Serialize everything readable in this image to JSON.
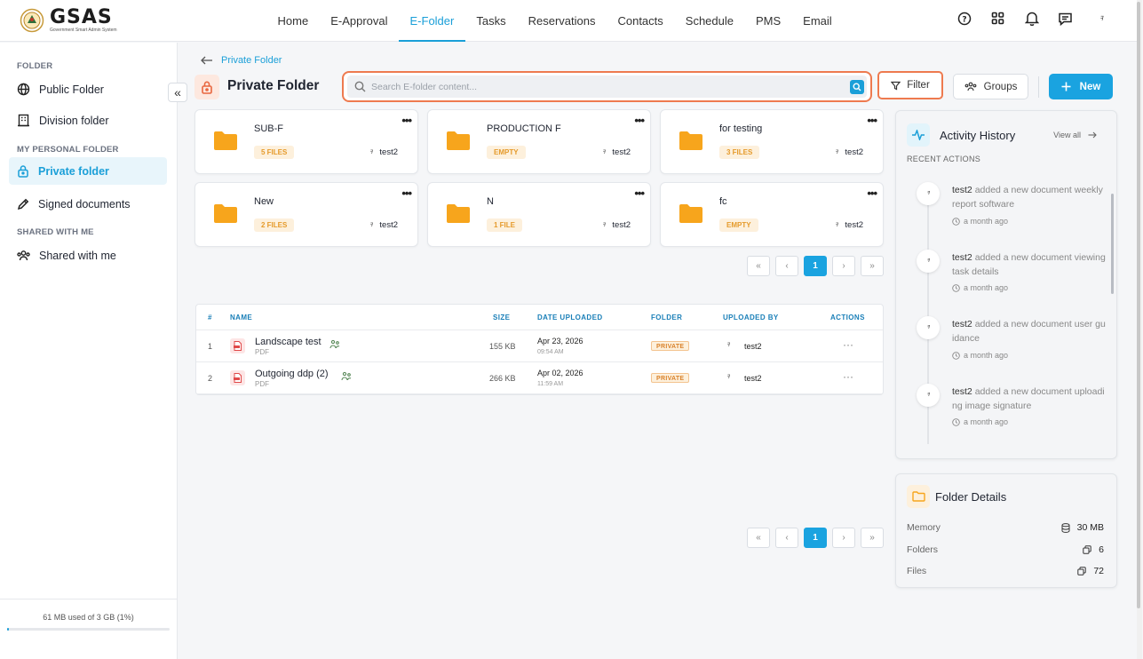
{
  "brand": {
    "name": "GSAS",
    "subtitle": "Government Smart Admin System"
  },
  "nav": [
    "Home",
    "E-Approval",
    "E-Folder",
    "Tasks",
    "Reservations",
    "Contacts",
    "Schedule",
    "PMS",
    "Email"
  ],
  "nav_active": "E-Folder",
  "user_signature": "ꟻ",
  "sidebar": {
    "section_folder": "FOLDER",
    "public_folder": "Public Folder",
    "division_folder": "Division folder",
    "section_personal": "MY PERSONAL FOLDER",
    "private_folder": "Private folder",
    "signed_documents": "Signed documents",
    "section_shared": "SHARED WITH ME",
    "shared_with_me": "Shared with me",
    "storage_text": "61 MB used of 3 GB (1%)",
    "storage_percent": 1
  },
  "header": {
    "breadcrumb": "Private Folder",
    "title": "Private Folder",
    "search_placeholder": "Search E-folder content...",
    "filter_label": "Filter",
    "groups_label": "Groups",
    "new_label": "New"
  },
  "folders": [
    {
      "name": "SUB-F",
      "badge": "5 FILES",
      "owner": "test2"
    },
    {
      "name": "PRODUCTION F",
      "badge": "EMPTY",
      "owner": "test2"
    },
    {
      "name": "for testing",
      "badge": "3 FILES",
      "owner": "test2"
    },
    {
      "name": "New",
      "badge": "2 FILES",
      "owner": "test2"
    },
    {
      "name": "N",
      "badge": "1 FILE",
      "owner": "test2"
    },
    {
      "name": "fc",
      "badge": "EMPTY",
      "owner": "test2"
    }
  ],
  "pagination": {
    "current": "1"
  },
  "table": {
    "headers": {
      "num": "#",
      "name": "NAME",
      "size": "SIZE",
      "date": "DATE UPLOADED",
      "folder": "FOLDER",
      "uploaded_by": "UPLOADED BY",
      "actions": "ACTIONS"
    },
    "rows": [
      {
        "num": "1",
        "name": "Landscape test",
        "type": "PDF",
        "size": "155 KB",
        "date": "Apr 23, 2026",
        "time": "09:54 AM",
        "folder": "PRIVATE",
        "uploaded_by": "test2"
      },
      {
        "num": "2",
        "name": "Outgoing ddp (2)",
        "type": "PDF",
        "size": "266 KB",
        "date": "Apr 02, 2026",
        "time": "11:59 AM",
        "folder": "PRIVATE",
        "uploaded_by": "test2"
      }
    ]
  },
  "activity": {
    "title": "Activity History",
    "view_all": "View all",
    "recent_label": "RECENT ACTIONS",
    "items": [
      {
        "user": "test2",
        "text": "added a new document weekly report software",
        "time": "a month ago"
      },
      {
        "user": "test2",
        "text": "added a new document viewing task details",
        "time": "a month ago"
      },
      {
        "user": "test2",
        "text": "added a new document user guidance",
        "time": "a month ago"
      },
      {
        "user": "test2",
        "text": "added a new document uploading image signature",
        "time": "a month ago"
      }
    ]
  },
  "folder_details": {
    "title": "Folder Details",
    "memory_label": "Memory",
    "memory_value": "30 MB",
    "folders_label": "Folders",
    "folders_value": "6",
    "files_label": "Files",
    "files_value": "72"
  },
  "colors": {
    "accent": "#1a9fd8",
    "highlight": "#ee7a4f",
    "folder": "#f7a51c"
  }
}
